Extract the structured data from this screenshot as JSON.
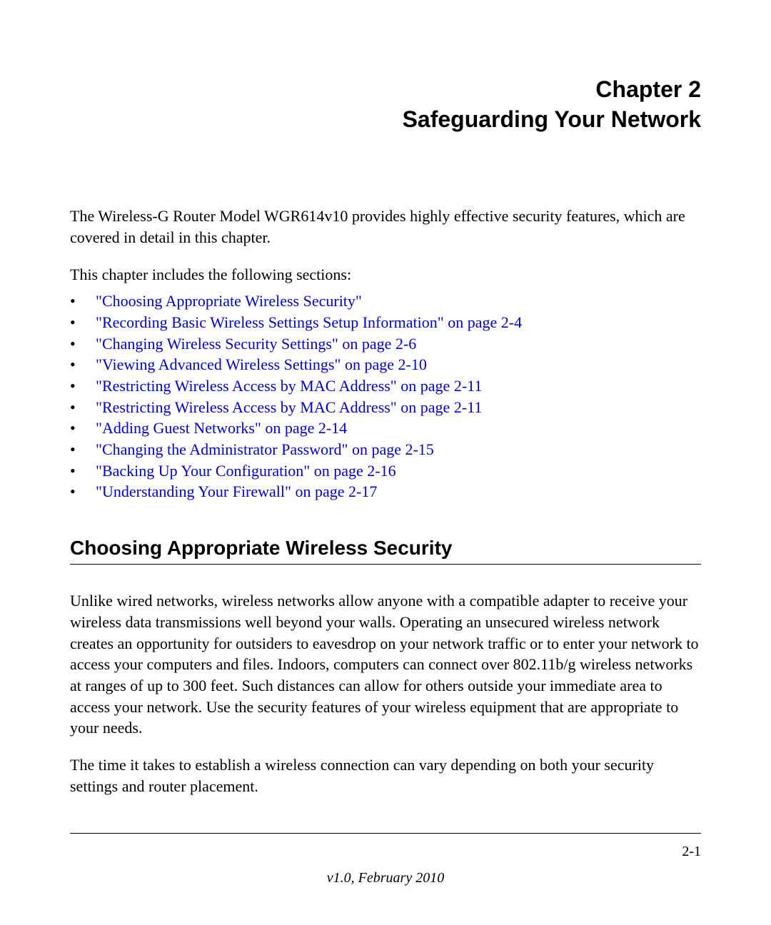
{
  "chapter": {
    "line1": "Chapter 2",
    "line2": "Safeguarding Your Network"
  },
  "intro_paragraph": "The Wireless-G Router Model WGR614v10 provides highly effective security features, which are covered in detail in this chapter.",
  "toc_intro": "This chapter includes the following sections:",
  "toc": [
    "\"Choosing Appropriate Wireless Security\"",
    "\"Recording Basic Wireless Settings Setup Information\" on page 2-4",
    "\"Changing Wireless Security Settings\" on page 2-6",
    "\"Viewing Advanced Wireless Settings\" on page 2-10",
    "\"Restricting Wireless Access by MAC Address\" on page 2-11",
    "\"Restricting Wireless Access by MAC Address\" on page 2-11",
    "\"Adding Guest Networks\" on page 2-14",
    "\"Changing the Administrator Password\" on page 2-15",
    "\"Backing Up Your Configuration\" on page 2-16",
    "\"Understanding Your Firewall\" on page 2-17"
  ],
  "section_heading": "Choosing Appropriate Wireless Security",
  "paragraph1": "Unlike wired networks, wireless networks allow anyone with a compatible adapter to receive your wireless data transmissions well beyond your walls. Operating an unsecured wireless network creates an opportunity for outsiders to eavesdrop on your network traffic or to enter your network to access your computers and files. Indoors, computers can connect over 802.11b/g wireless networks at ranges of up to 300 feet. Such distances can allow for others outside your immediate area to access your network. Use the security features of your wireless equipment that are appropriate to your needs.",
  "paragraph2": "The time it takes to establish a wireless connection can vary depending on both your security settings and router placement.",
  "footer": {
    "page_number": "2-1",
    "version": "v1.0, February 2010"
  }
}
